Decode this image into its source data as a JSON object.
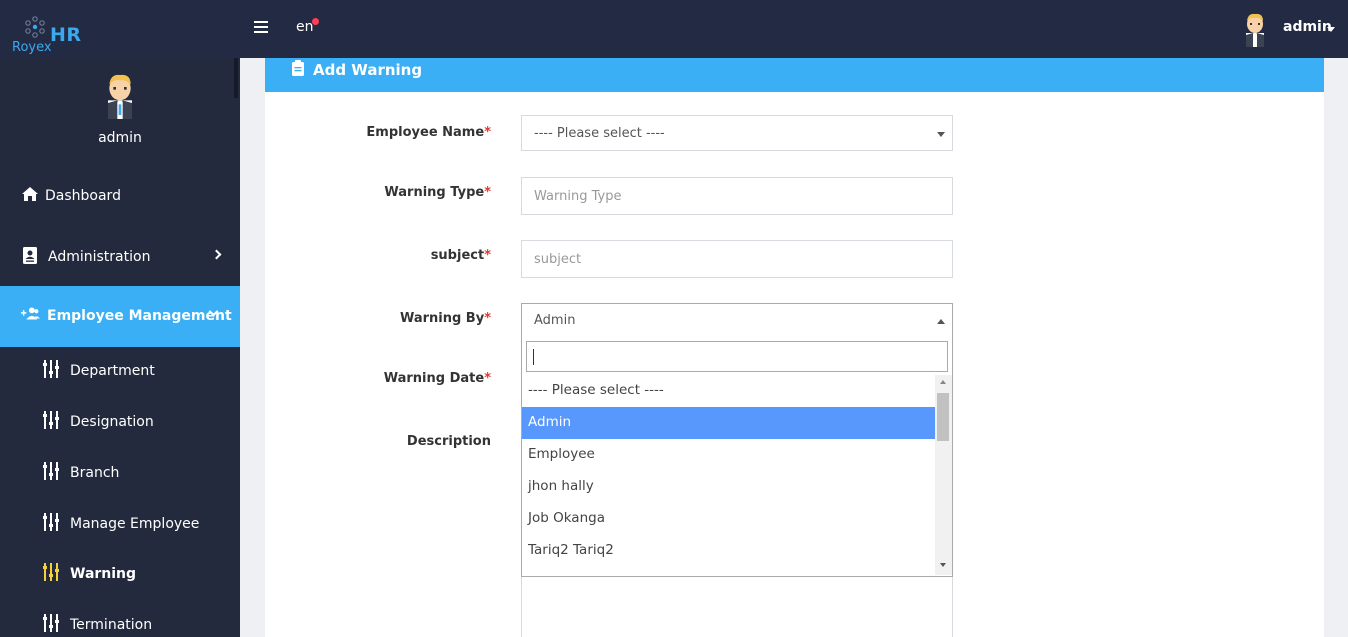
{
  "brand": {
    "logo_text": "HR",
    "logo_sub": "Royex"
  },
  "topbar": {
    "language": "en",
    "user": "admin"
  },
  "sidebar": {
    "user": "admin",
    "items": [
      {
        "label": "Dashboard",
        "icon": "home-icon"
      },
      {
        "label": "Administration",
        "icon": "contact-card-icon"
      },
      {
        "label": "Employee Management",
        "icon": "users-icon"
      }
    ],
    "sub_items": [
      {
        "label": "Department"
      },
      {
        "label": "Designation"
      },
      {
        "label": "Branch"
      },
      {
        "label": "Manage Employee"
      },
      {
        "label": "Warning"
      },
      {
        "label": "Termination"
      }
    ]
  },
  "panel": {
    "title": "Add Warning"
  },
  "form": {
    "employee_name": {
      "label": "Employee Name",
      "value": "---- Please select ----"
    },
    "warning_type": {
      "label": "Warning Type",
      "placeholder": "Warning Type"
    },
    "subject": {
      "label": "subject",
      "placeholder": "subject"
    },
    "warning_by": {
      "label": "Warning By",
      "value": "Admin"
    },
    "warning_date": {
      "label": "Warning Date"
    },
    "description": {
      "label": "Description"
    },
    "required_mark": "*"
  },
  "dropdown": {
    "search_value": "",
    "options": [
      "---- Please select ----",
      "Admin",
      "Employee",
      "jhon hally",
      "Job Okanga",
      "Tariq2 Tariq2"
    ],
    "selected": "Admin"
  },
  "colors": {
    "topbar": "#232a43",
    "sidebar": "#232a3d",
    "accent": "#3aaff5",
    "highlight": "#5897fb",
    "required": "#e3342f",
    "warning_icon": "#f4d03f"
  }
}
